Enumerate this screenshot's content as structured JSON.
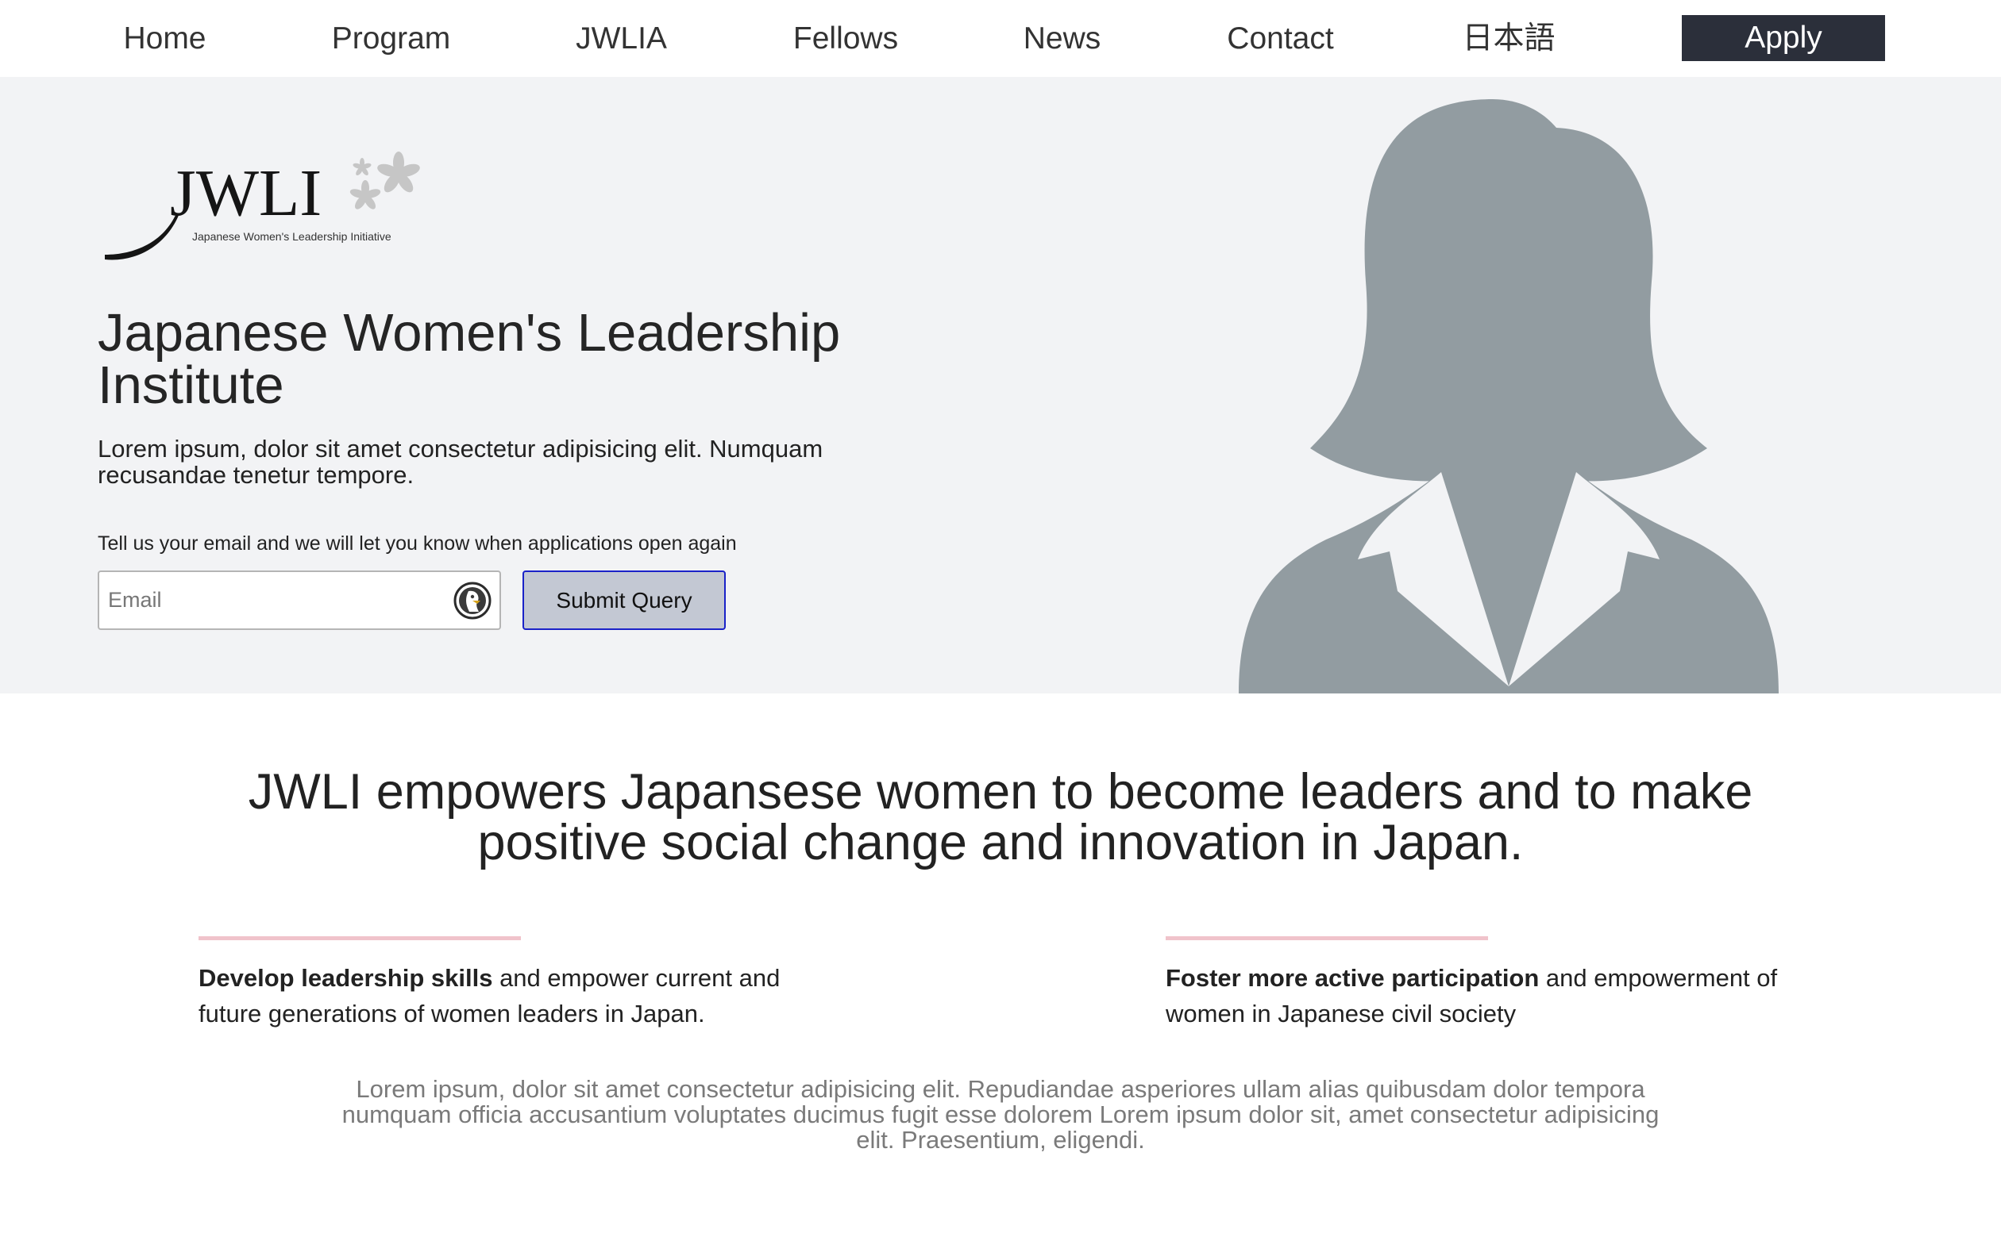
{
  "nav": {
    "items": [
      {
        "label": "Home"
      },
      {
        "label": "Program"
      },
      {
        "label": "JWLIA"
      },
      {
        "label": "Fellows"
      },
      {
        "label": "News"
      },
      {
        "label": "Contact"
      },
      {
        "label": "日本語"
      }
    ],
    "apply_label": "Apply"
  },
  "logo": {
    "wordmark": "JWLI",
    "tagline": "Japanese Women's Leadership Initiative"
  },
  "hero": {
    "title": "Japanese Women's Leadership Institute",
    "lead": "Lorem ipsum, dolor sit amet consectetur adipisicing elit. Numquam recusandae tenetur tempore.",
    "prompt": "Tell us your email and we will let you know when applications open again",
    "email_placeholder": "Email",
    "email_value": "",
    "submit_label": "Submit Query",
    "silhouette_icon": "woman-silhouette-icon"
  },
  "mission": {
    "text": "JWLI empowers Japansese women to become leaders and to make positive social change and innovation in Japan."
  },
  "pillars": [
    {
      "bold": "Develop leadership skills",
      "rest": " and empower current and future generations of women leaders in Japan."
    },
    {
      "bold": "Foster more active participation",
      "rest": " and empowerment of women in Japanese civil society"
    }
  ],
  "footer": {
    "text": "Lorem ipsum, dolor sit amet consectetur adipisicing elit. Repudiandae asperiores ullam alias quibusdam dolor tempora numquam officia accusantium voluptates ducimus fugit esse dolorem Lorem ipsum dolor sit, amet consectetur adipisicing elit. Praesentium, eligendi."
  },
  "colors": {
    "nav_apply_bg": "#2b2f3a",
    "hero_bg": "#f2f3f5",
    "silhouette": "#929ca1",
    "pillar_accent": "#f0c3cb",
    "submit_border": "#1a22c8"
  }
}
